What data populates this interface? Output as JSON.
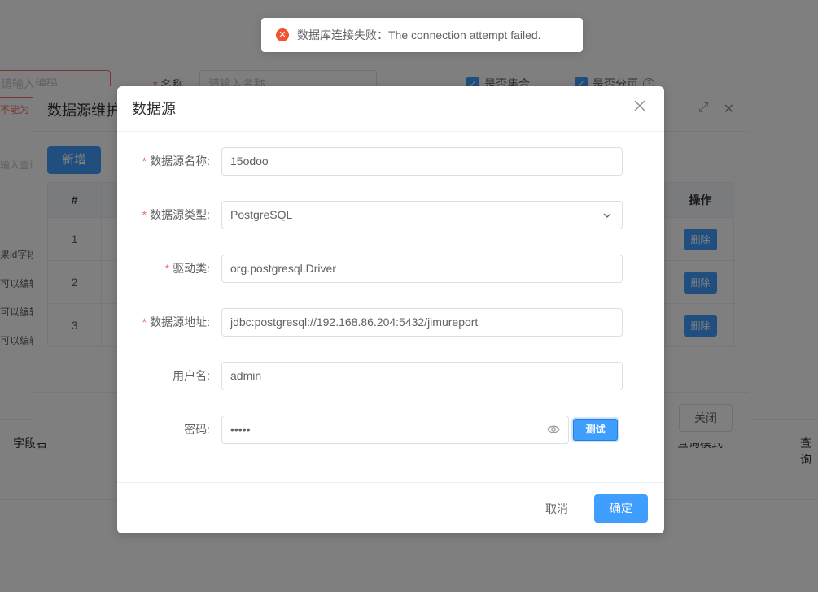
{
  "toast": {
    "icon": "error-circle-icon",
    "message": "数据库连接失败：The connection attempt failed."
  },
  "background": {
    "code_placeholder": "请输入编码",
    "code_error": "不能为",
    "name_label": "名称",
    "name_placeholder": "请输入名称",
    "check_collection": "是否集合",
    "check_paging": "是否分页",
    "search_placeholder": "输入查询",
    "row_labels": [
      "果id字段",
      "可以编辑",
      "可以编辑",
      "可以编辑"
    ],
    "footer_left": "字段名",
    "footer_mid": "查询模式",
    "footer_right": "查询"
  },
  "middle_dialog": {
    "title": "数据源维护",
    "add_label": "新增",
    "col_index": "#",
    "col_ops": "操作",
    "rows": [
      {
        "index": "1",
        "delete_label": "删除"
      },
      {
        "index": "2",
        "delete_label": "删除"
      },
      {
        "index": "3",
        "delete_label": "删除"
      }
    ],
    "close_label": "关闭"
  },
  "dialog": {
    "title": "数据源",
    "fields": {
      "name": {
        "label": "数据源名称:",
        "value": "15odoo",
        "required": true
      },
      "type": {
        "label": "数据源类型:",
        "value": "PostgreSQL",
        "required": true
      },
      "driver": {
        "label": "驱动类:",
        "value": "org.postgresql.Driver",
        "required": true
      },
      "url": {
        "label": "数据源地址:",
        "value": "jdbc:postgresql://192.168.86.204:5432/jimureport",
        "required": true
      },
      "username": {
        "label": "用户名:",
        "value": "admin",
        "required": false
      },
      "password": {
        "label": "密码:",
        "value": "•••••",
        "required": false
      }
    },
    "test_label": "测试",
    "cancel_label": "取消",
    "ok_label": "确定"
  }
}
